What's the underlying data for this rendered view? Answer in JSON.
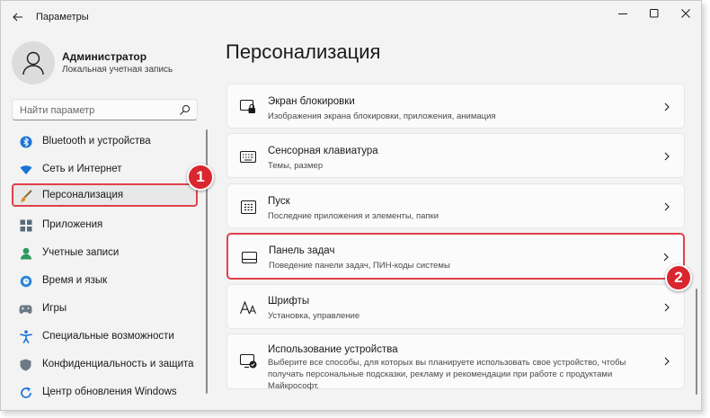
{
  "app": {
    "title": "Параметры"
  },
  "user": {
    "name": "Администратор",
    "account_type": "Локальная учетная запись"
  },
  "search": {
    "placeholder": "Найти параметр"
  },
  "sidebar": {
    "items": [
      {
        "label": "Bluetooth и устройства",
        "icon": "bluetooth-icon"
      },
      {
        "label": "Сеть и Интернет",
        "icon": "wifi-icon"
      },
      {
        "label": "Персонализация",
        "icon": "brush-icon",
        "selected": true
      },
      {
        "label": "Приложения",
        "icon": "apps-icon"
      },
      {
        "label": "Учетные записи",
        "icon": "accounts-icon"
      },
      {
        "label": "Время и язык",
        "icon": "globe-clock-icon"
      },
      {
        "label": "Игры",
        "icon": "gamepad-icon"
      },
      {
        "label": "Специальные возможности",
        "icon": "accessibility-icon"
      },
      {
        "label": "Конфиденциальность и защита",
        "icon": "shield-icon"
      },
      {
        "label": "Центр обновления Windows",
        "icon": "update-icon"
      }
    ]
  },
  "main": {
    "title": "Персонализация",
    "cards": [
      {
        "title": "Экран блокировки",
        "subtitle": "Изображения экрана блокировки, приложения, анимация",
        "icon": "lock-screen-icon"
      },
      {
        "title": "Сенсорная клавиатура",
        "subtitle": "Темы, размер",
        "icon": "keyboard-icon"
      },
      {
        "title": "Пуск",
        "subtitle": "Последние приложения и элементы, папки",
        "icon": "start-icon"
      },
      {
        "title": "Панель задач",
        "subtitle": "Поведение панели задач, ПИН-коды системы",
        "icon": "taskbar-icon",
        "highlighted": true
      },
      {
        "title": "Шрифты",
        "subtitle": "Установка, управление",
        "icon": "fonts-icon"
      },
      {
        "title": "Использование устройства",
        "subtitle": "Выберите все способы, для которых вы планируете использовать свое устройство, чтобы получать персональные подсказки, рекламу и рекомендации при работе с продуктами Майкрософт.",
        "icon": "device-usage-icon"
      }
    ]
  },
  "annotations": {
    "badge1": "1",
    "badge2": "2"
  },
  "colors": {
    "highlight": "#e0404a",
    "badge": "#d9262f",
    "accent": "#0067c0"
  }
}
